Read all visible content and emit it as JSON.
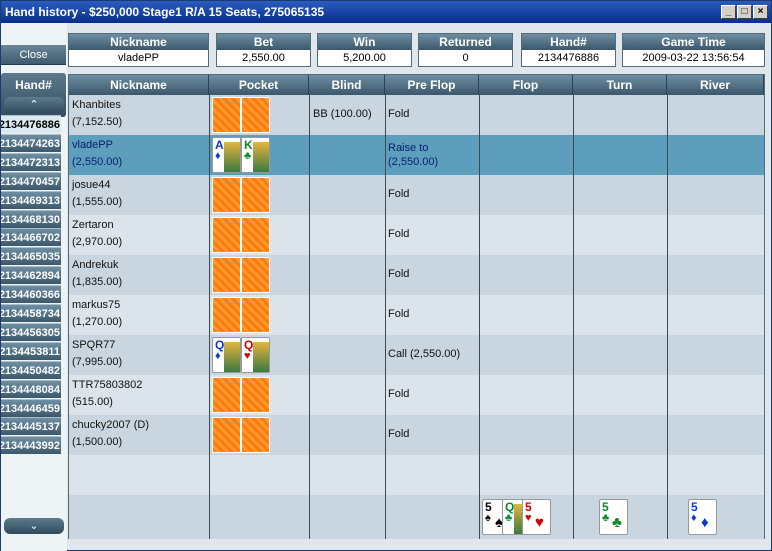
{
  "window": {
    "title": "Hand history - $250,000 Stage1 R/A 15 Seats, 275065135",
    "min_label": "_",
    "max_label": "□",
    "close_label": "×"
  },
  "sidebar": {
    "close_label": "Close",
    "hand_header": "Hand#",
    "up_arrow": "⌃",
    "down_arrow": "⌄",
    "hands": [
      "2134476886",
      "2134474263",
      "2134472313",
      "2134470457",
      "2134469313",
      "2134468130",
      "2134466702",
      "2134465035",
      "2134462894",
      "2134460366",
      "2134458734",
      "2134456305",
      "2134453811",
      "2134450482",
      "2134448084",
      "2134446459",
      "2134445137",
      "2134443992"
    ],
    "selected_index": 0
  },
  "summary": {
    "nickname": {
      "label": "Nickname",
      "value": "vladePP"
    },
    "bet": {
      "label": "Bet",
      "value": "2,550.00"
    },
    "win": {
      "label": "Win",
      "value": "5,200.00"
    },
    "returned": {
      "label": "Returned",
      "value": "0"
    },
    "hand": {
      "label": "Hand#",
      "value": "2134476886"
    },
    "game_time": {
      "label": "Game Time",
      "value": "2009-03-22 13:56:54"
    }
  },
  "table": {
    "headers": [
      "Nickname",
      "Pocket",
      "Blind",
      "Pre Flop",
      "Flop",
      "Turn",
      "River"
    ],
    "rows": [
      {
        "name": "Khanbites",
        "stack": "(7,152.50)",
        "pocket": "back",
        "blind": "BB (100.00)",
        "preflop": "Fold",
        "preflop2": ""
      },
      {
        "name": "vladePP",
        "stack": "(2,550.00)",
        "pocket": "AK",
        "blind": "",
        "preflop": "Raise to",
        "preflop2": "(2,550.00)"
      },
      {
        "name": "josue44",
        "stack": "(1,555.00)",
        "pocket": "back",
        "blind": "",
        "preflop": "Fold",
        "preflop2": ""
      },
      {
        "name": "Zertaron",
        "stack": "(2,970.00)",
        "pocket": "back",
        "blind": "",
        "preflop": "Fold",
        "preflop2": ""
      },
      {
        "name": "Andrekuk",
        "stack": "(1,835.00)",
        "pocket": "back",
        "blind": "",
        "preflop": "Fold",
        "preflop2": ""
      },
      {
        "name": "markus75",
        "stack": "(1,270.00)",
        "pocket": "back",
        "blind": "",
        "preflop": "Fold",
        "preflop2": ""
      },
      {
        "name": "SPQR77",
        "stack": "(7,995.00)",
        "pocket": "QQ",
        "blind": "",
        "preflop": "Call (2,550.00)",
        "preflop2": ""
      },
      {
        "name": "TTR75803802",
        "stack": "(515.00)",
        "pocket": "back",
        "blind": "",
        "preflop": "Fold",
        "preflop2": ""
      },
      {
        "name": "chucky2007 (D)",
        "stack": "(1,500.00)",
        "pocket": "back",
        "blind": "",
        "preflop": "Fold",
        "preflop2": ""
      }
    ],
    "board": {
      "flop": [
        {
          "rank": "5",
          "suit": "♠",
          "color": "blk"
        },
        {
          "rank": "Q",
          "suit": "♣",
          "color": "grn"
        },
        {
          "rank": "5",
          "suit": "♥",
          "color": "red"
        }
      ],
      "turn": [
        {
          "rank": "5",
          "suit": "♣",
          "color": "grn"
        }
      ],
      "river": [
        {
          "rank": "5",
          "suit": "♦",
          "color": "blu"
        }
      ]
    },
    "pocket_cards": {
      "AK": [
        {
          "rank": "A",
          "suit": "♦",
          "color": "blu"
        },
        {
          "rank": "K",
          "suit": "♣",
          "color": "grn"
        }
      ],
      "QQ": [
        {
          "rank": "Q",
          "suit": "♦",
          "color": "blu"
        },
        {
          "rank": "Q",
          "suit": "♥",
          "color": "red"
        }
      ]
    }
  }
}
